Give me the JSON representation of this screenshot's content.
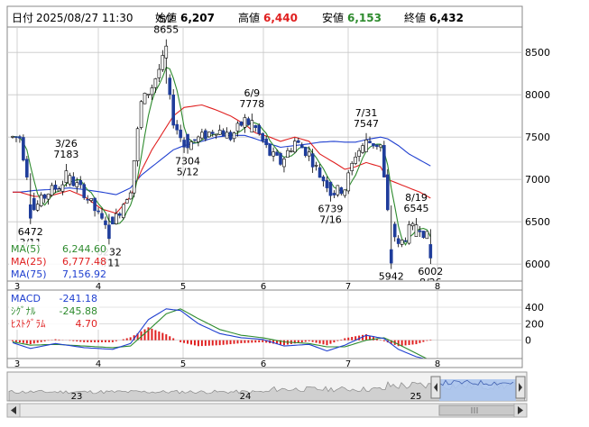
{
  "header": {
    "date_label": "日付",
    "date_value": "2025/08/27 11:30",
    "open_label": "始値",
    "open_value": "6,207",
    "high_label": "高値",
    "high_value": "6,440",
    "low_label": "安値",
    "low_value": "6,153",
    "close_label": "終値",
    "close_value": "6,432"
  },
  "colors": {
    "up": "#ffffff",
    "down": "#1f3d9b",
    "wick": "#000000",
    "ma5": "#2e8b2e",
    "ma25": "#e02020",
    "ma75": "#2040d0",
    "macd": "#2040d0",
    "signal": "#2e8b2e",
    "hist": "#e02020",
    "high_value": "#e02020",
    "low_value": "#2e8b2e",
    "grid": "#c8c8c8",
    "nav_fill": "#aac4ee"
  },
  "legend": [
    {
      "label": "MA(5)",
      "value": "6,244.60",
      "color": "#2e8b2e"
    },
    {
      "label": "MA(25)",
      "value": "6,777.48",
      "color": "#e02020"
    },
    {
      "label": "MA(75)",
      "value": "7,156.92",
      "color": "#2040d0"
    }
  ],
  "macd_legend": [
    {
      "label": "MACD",
      "value": "-241.18",
      "color": "#2040d0"
    },
    {
      "label": "ｼｸﾞﾅﾙ",
      "value": "-245.88",
      "color": "#2e8b2e"
    },
    {
      "label": "ﾋｽﾄｸﾞﾗﾑ",
      "value": "4.70",
      "color": "#e02020"
    }
  ],
  "nav_labels": [
    "23",
    "24",
    "25"
  ],
  "chart_data": [
    {
      "type": "candlestick",
      "title": "",
      "x_ticks": [
        "3",
        "4",
        "5",
        "6",
        "7",
        "8"
      ],
      "y_ticks": [
        6000,
        6500,
        7000,
        7500,
        8000,
        8500
      ],
      "ylim": [
        5800,
        8800
      ],
      "grid": true,
      "annotations": [
        {
          "date": "3/11",
          "value": "6472",
          "text_top": "6472",
          "text_bottom": "3/11"
        },
        {
          "date": "3/26",
          "value": "7183",
          "text_top": "3/26",
          "text_bottom": "7183"
        },
        {
          "date": "4/11",
          "value": "6232",
          "text_top": "6232",
          "text_bottom": "4/11"
        },
        {
          "date": "5/2",
          "value": "8655",
          "text_top": "5/2",
          "text_bottom": "8655"
        },
        {
          "date": "5/12",
          "value": "7304",
          "text_top": "7304",
          "text_bottom": "5/12"
        },
        {
          "date": "6/9",
          "value": "7778",
          "text_top": "6/9",
          "text_bottom": "7778"
        },
        {
          "date": "7/16",
          "value": "6739",
          "text_top": "6739",
          "text_bottom": "7/16"
        },
        {
          "date": "7/31",
          "value": "7547",
          "text_top": "7/31",
          "text_bottom": "7547"
        },
        {
          "date": "8/8",
          "value": "5942",
          "text_top": "5942",
          "text_bottom": "8/8"
        },
        {
          "date": "8/19",
          "value": "6545",
          "text_top": "8/19",
          "text_bottom": "6545"
        },
        {
          "date": "8/26",
          "value": "6002",
          "text_top": "6002",
          "text_bottom": "8/26"
        }
      ],
      "anchors": [
        {
          "i": 0,
          "v": 7500,
          "ma25": 6850,
          "ma75": 6850
        },
        {
          "i": 2,
          "v": 7500,
          "ma25": 6850,
          "ma75": 6850
        },
        {
          "i": 6,
          "v": 6650,
          "ma25": 6800,
          "ma75": 6870
        },
        {
          "i": 10,
          "v": 6850,
          "ma25": 6800,
          "ma75": 6880
        },
        {
          "i": 16,
          "v": 7000,
          "ma25": 6870,
          "ma75": 6900
        },
        {
          "i": 20,
          "v": 6850,
          "ma25": 6800,
          "ma75": 6880
        },
        {
          "i": 25,
          "v": 6500,
          "ma25": 6650,
          "ma75": 6850
        },
        {
          "i": 29,
          "v": 6550,
          "ma25": 6600,
          "ma75": 6820
        },
        {
          "i": 33,
          "v": 6900,
          "ma25": 6800,
          "ma75": 6900
        },
        {
          "i": 36,
          "v": 7900,
          "ma25": 7100,
          "ma75": 7050
        },
        {
          "i": 39,
          "v": 8100,
          "ma25": 7350,
          "ma75": 7150
        },
        {
          "i": 42,
          "v": 8400,
          "ma25": 7550,
          "ma75": 7250
        },
        {
          "i": 45,
          "v": 7700,
          "ma25": 7750,
          "ma75": 7350
        },
        {
          "i": 48,
          "v": 7400,
          "ma25": 7850,
          "ma75": 7400
        },
        {
          "i": 53,
          "v": 7500,
          "ma25": 7880,
          "ma75": 7450
        },
        {
          "i": 57,
          "v": 7600,
          "ma25": 7820,
          "ma75": 7500
        },
        {
          "i": 61,
          "v": 7500,
          "ma25": 7750,
          "ma75": 7520
        },
        {
          "i": 65,
          "v": 7700,
          "ma25": 7650,
          "ma75": 7520
        },
        {
          "i": 68,
          "v": 7600,
          "ma25": 7550,
          "ma75": 7480
        },
        {
          "i": 72,
          "v": 7300,
          "ma25": 7500,
          "ma75": 7420
        },
        {
          "i": 75,
          "v": 7200,
          "ma25": 7450,
          "ma75": 7380
        },
        {
          "i": 79,
          "v": 7450,
          "ma25": 7500,
          "ma75": 7400
        },
        {
          "i": 83,
          "v": 7300,
          "ma25": 7450,
          "ma75": 7420
        },
        {
          "i": 86,
          "v": 7050,
          "ma25": 7300,
          "ma75": 7440
        },
        {
          "i": 90,
          "v": 6850,
          "ma25": 7200,
          "ma75": 7450
        },
        {
          "i": 93,
          "v": 6900,
          "ma25": 7120,
          "ma75": 7440
        },
        {
          "i": 96,
          "v": 7300,
          "ma25": 7150,
          "ma75": 7440
        },
        {
          "i": 99,
          "v": 7450,
          "ma25": 7200,
          "ma75": 7470
        },
        {
          "i": 103,
          "v": 7400,
          "ma25": 7150,
          "ma75": 7500
        },
        {
          "i": 105,
          "v": 6600,
          "ma25": 7000,
          "ma75": 7480
        },
        {
          "i": 108,
          "v": 6200,
          "ma25": 6950,
          "ma75": 7400
        },
        {
          "i": 111,
          "v": 6400,
          "ma25": 6900,
          "ma75": 7300
        },
        {
          "i": 114,
          "v": 6450,
          "ma25": 6850,
          "ma75": 7230
        },
        {
          "i": 117,
          "v": 6250,
          "ma25": 6780,
          "ma75": 7160
        }
      ],
      "extremes": [
        {
          "i": 5,
          "low": 6472
        },
        {
          "i": 15,
          "high": 7183
        },
        {
          "i": 27,
          "low": 6232
        },
        {
          "i": 43,
          "high": 8655
        },
        {
          "i": 49,
          "low": 7304
        },
        {
          "i": 67,
          "high": 7778
        },
        {
          "i": 89,
          "low": 6739
        },
        {
          "i": 99,
          "high": 7547
        },
        {
          "i": 106,
          "low": 5942
        },
        {
          "i": 113,
          "high": 6545
        },
        {
          "i": 117,
          "low": 6002
        }
      ],
      "macd": {
        "ylim": [
          -200,
          520
        ],
        "y_ticks": [
          400,
          200,
          0
        ],
        "anchors": [
          {
            "i": 0,
            "m": -30,
            "s": -20
          },
          {
            "i": 5,
            "m": -100,
            "s": -60
          },
          {
            "i": 12,
            "m": -40,
            "s": -50
          },
          {
            "i": 20,
            "m": -90,
            "s": -70
          },
          {
            "i": 28,
            "m": -110,
            "s": -90
          },
          {
            "i": 33,
            "m": -40,
            "s": -70
          },
          {
            "i": 38,
            "m": 250,
            "s": 120
          },
          {
            "i": 43,
            "m": 380,
            "s": 320
          },
          {
            "i": 47,
            "m": 360,
            "s": 380
          },
          {
            "i": 52,
            "m": 200,
            "s": 260
          },
          {
            "i": 58,
            "m": 80,
            "s": 130
          },
          {
            "i": 64,
            "m": 30,
            "s": 60
          },
          {
            "i": 70,
            "m": 10,
            "s": 30
          },
          {
            "i": 76,
            "m": -70,
            "s": -20
          },
          {
            "i": 83,
            "m": -50,
            "s": -40
          },
          {
            "i": 88,
            "m": -130,
            "s": -80
          },
          {
            "i": 93,
            "m": -60,
            "s": -80
          },
          {
            "i": 99,
            "m": 60,
            "s": 0
          },
          {
            "i": 104,
            "m": 20,
            "s": 30
          },
          {
            "i": 108,
            "m": -110,
            "s": -50
          },
          {
            "i": 113,
            "m": -200,
            "s": -160
          },
          {
            "i": 117,
            "m": -241,
            "s": -246
          }
        ]
      }
    }
  ]
}
